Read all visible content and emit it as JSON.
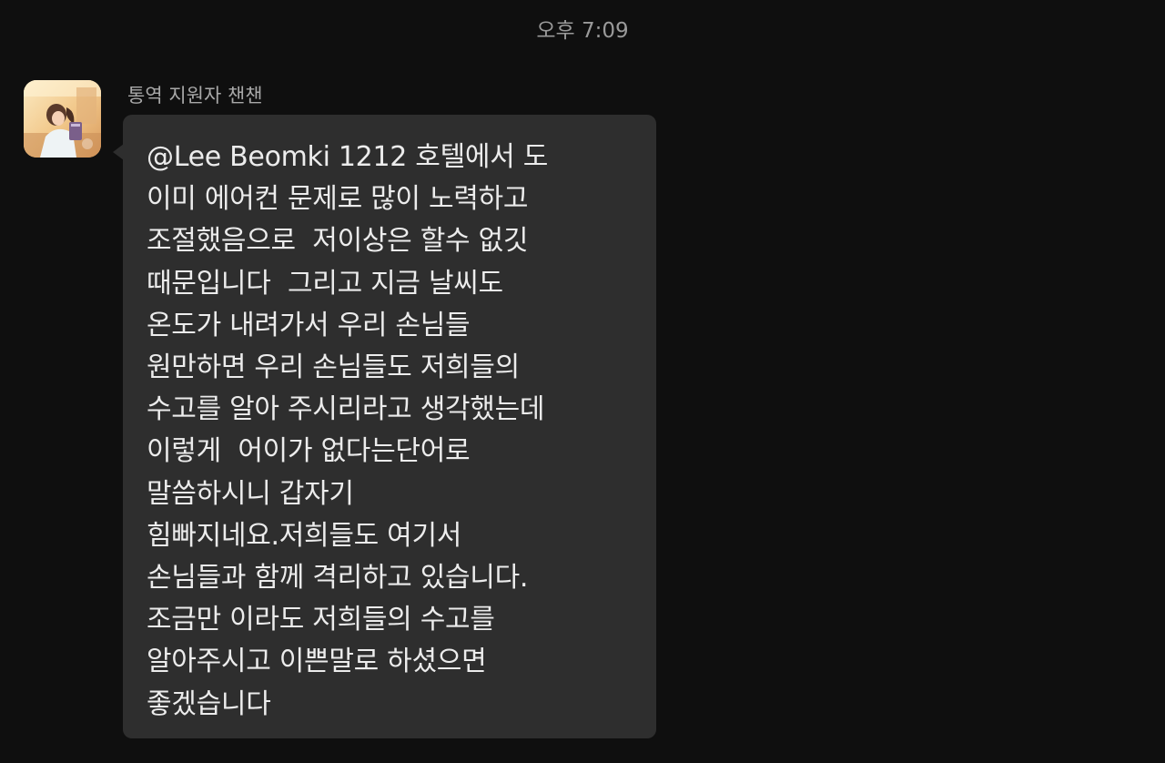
{
  "timestamp": "오후 7:09",
  "message": {
    "sender": "통역 지원자 챈챈",
    "avatar": "avatar-girl-reading",
    "lines": [
      "@Lee Beomki 1212 호텔에서 도",
      "이미 에어컨 문제로 많이 노력하고",
      "조절했음으로  저이상은 할수 없깃",
      "때문입니다  그리고 지금 날씨도",
      "온도가 내려가서 우리 손님들",
      "원만하면 우리 손님들도 저희들의",
      "수고를 알아 주시리라고 생각했는데",
      "이렇게  어이가 없다는단어로",
      "말씀하시니 갑자기",
      "힘빠지네요.저희들도 여기서",
      "손님들과 함께 격리하고 있습니다.",
      "조금만 이라도 저희들의 수고를",
      "알아주시고 이쁜말로 하셨으면",
      "좋겠습니다"
    ]
  },
  "colors": {
    "background": "#0f0f0f",
    "bubble": "#2e2e2e",
    "text": "#ececec",
    "meta_text": "#9a9a9a"
  }
}
